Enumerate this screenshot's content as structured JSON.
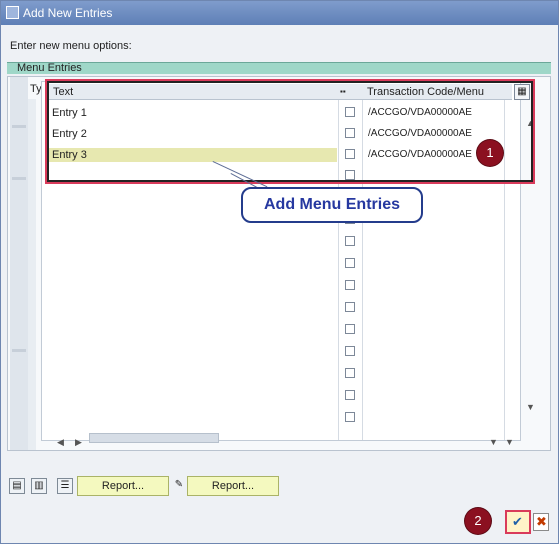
{
  "window": {
    "title": "Add New Entries"
  },
  "prompt": "Enter new menu options:",
  "group": {
    "label": "Menu Entries"
  },
  "left_cols": {
    "ty": "Ty."
  },
  "table": {
    "headers": {
      "text": "Text",
      "tcode": "Transaction Code/Menu"
    },
    "rows": [
      {
        "text": "Entry 1",
        "tcode": "/ACCGO/VDA00000AE"
      },
      {
        "text": "Entry 2",
        "tcode": "/ACCGO/VDA00000AE"
      },
      {
        "text": "Entry 3",
        "tcode": "/ACCGO/VDA00000AE"
      }
    ]
  },
  "callout": {
    "label": "Add Menu Entries",
    "step1": "1",
    "step2": "2"
  },
  "buttons": {
    "report1": "Report...",
    "report2": "Report..."
  },
  "colors": {
    "accent": "#d93b5b",
    "badge": "#8b1020",
    "callout_text": "#2638a0"
  },
  "icons": [
    "window-icon",
    "table-settings-icon",
    "ok-icon",
    "cancel-icon",
    "pencil-icon"
  ]
}
